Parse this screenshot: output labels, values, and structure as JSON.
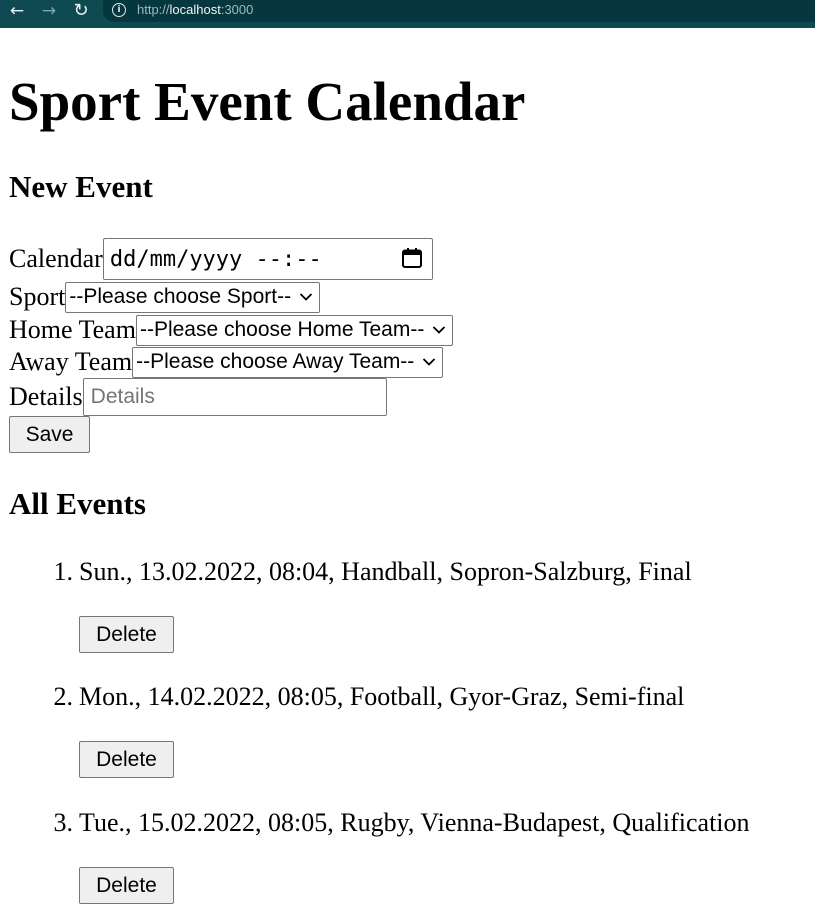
{
  "browser": {
    "url_scheme": "http://",
    "url_host": "localhost",
    "url_port": ":3000"
  },
  "page": {
    "title": "Sport Event Calendar"
  },
  "new_event": {
    "heading": "New Event",
    "calendar_label": "Calendar",
    "calendar_placeholder": "dd/mm/yyyy --:--",
    "sport_label": "Sport",
    "sport_selected": "--Please choose Sport--",
    "home_label": "Home Team",
    "home_selected": "--Please choose Home Team--",
    "away_label": "Away Team",
    "away_selected": "--Please choose Away Team--",
    "details_label": "Details",
    "details_placeholder": "Details",
    "details_value": "",
    "save_label": "Save"
  },
  "all_events": {
    "heading": "All Events",
    "delete_label": "Delete",
    "items": [
      {
        "number": "1.",
        "text": "Sun., 13.02.2022, 08:04, Handball, Sopron-Salzburg, Final"
      },
      {
        "number": "2.",
        "text": "Mon., 14.02.2022, 08:05, Football, Gyor-Graz, Semi-final"
      },
      {
        "number": "3.",
        "text": "Tue., 15.02.2022, 08:05, Rugby, Vienna-Budapest, Qualification"
      }
    ]
  },
  "icons": {
    "back": "arrow-left-icon",
    "forward": "arrow-right-icon",
    "reload": "reload-icon",
    "info": "info-icon",
    "calendar": "calendar-icon",
    "dropdown": "chevron-down-icon"
  },
  "colors": {
    "browser_toolbar": "#0f4a53",
    "omnibox": "#06363e",
    "button_bg": "#efefef",
    "input_border": "#767676",
    "placeholder": "#757575"
  }
}
